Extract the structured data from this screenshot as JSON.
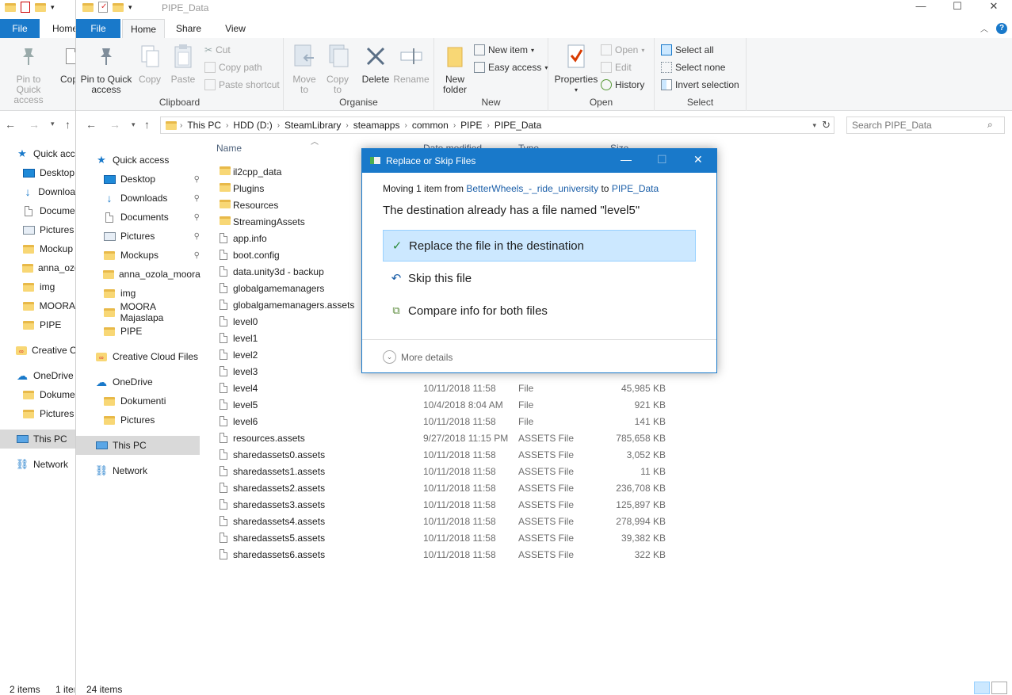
{
  "back_window": {
    "file_tab": "File",
    "home_tab": "Home",
    "ribbon": {
      "pin_label": "Pin to Quick access",
      "copy_partial": "Cop"
    },
    "nav_items": [
      {
        "label": "Quick acc",
        "icon": "star-icon"
      },
      {
        "label": "Desktop",
        "icon": "desktop-icon"
      },
      {
        "label": "Downloa",
        "icon": "download-icon"
      },
      {
        "label": "Docume",
        "icon": "document-icon"
      },
      {
        "label": "Pictures",
        "icon": "pictures-icon"
      },
      {
        "label": "Mockup",
        "icon": "folder-icon"
      },
      {
        "label": "anna_ozo",
        "icon": "folder-icon"
      },
      {
        "label": "img",
        "icon": "folder-icon"
      },
      {
        "label": "MOORA",
        "icon": "folder-icon"
      },
      {
        "label": "PIPE",
        "icon": "folder-icon"
      },
      {
        "label": "Creative C",
        "icon": "creative-cloud-icon"
      },
      {
        "label": "OneDrive",
        "icon": "onedrive-icon"
      },
      {
        "label": "Dokume",
        "icon": "folder-icon"
      },
      {
        "label": "Pictures",
        "icon": "folder-icon"
      },
      {
        "label": "This PC",
        "icon": "this-pc-icon"
      },
      {
        "label": "Network",
        "icon": "network-icon"
      }
    ],
    "status_items": "2 items",
    "status_selected": "1 iter"
  },
  "window": {
    "title": "PIPE_Data",
    "tabs": {
      "file": "File",
      "home": "Home",
      "share": "Share",
      "view": "View"
    },
    "ribbon": {
      "clipboard": {
        "label": "Clipboard",
        "pin": "Pin to Quick access",
        "copy": "Copy",
        "paste": "Paste",
        "cut": "Cut",
        "copy_path": "Copy path",
        "paste_shortcut": "Paste shortcut"
      },
      "organise": {
        "label": "Organise",
        "move_to": "Move to",
        "copy_to": "Copy to",
        "delete": "Delete",
        "rename": "Rename"
      },
      "new": {
        "label": "New",
        "new_folder": "New folder",
        "new_item": "New item",
        "easy_access": "Easy access"
      },
      "open": {
        "label": "Open",
        "properties": "Properties",
        "open": "Open",
        "edit": "Edit",
        "history": "History"
      },
      "select": {
        "label": "Select",
        "select_all": "Select all",
        "select_none": "Select none",
        "invert": "Invert selection"
      }
    },
    "breadcrumb": [
      "This PC",
      "HDD (D:)",
      "SteamLibrary",
      "steamapps",
      "common",
      "PIPE",
      "PIPE_Data"
    ],
    "search_placeholder": "Search PIPE_Data",
    "nav_items": [
      {
        "label": "Quick access",
        "icon": "star-icon",
        "pinned": false
      },
      {
        "label": "Desktop",
        "icon": "desktop-icon",
        "pinned": true
      },
      {
        "label": "Downloads",
        "icon": "download-icon",
        "pinned": true
      },
      {
        "label": "Documents",
        "icon": "document-icon",
        "pinned": true
      },
      {
        "label": "Pictures",
        "icon": "pictures-icon",
        "pinned": true
      },
      {
        "label": "Mockups",
        "icon": "folder-icon",
        "pinned": true
      },
      {
        "label": "anna_ozola_moora",
        "icon": "folder-icon",
        "pinned": false
      },
      {
        "label": "img",
        "icon": "folder-icon",
        "pinned": false
      },
      {
        "label": "MOORA Majaslapa",
        "icon": "folder-icon",
        "pinned": false
      },
      {
        "label": "PIPE",
        "icon": "folder-icon",
        "pinned": false
      },
      {
        "label": "Creative Cloud Files",
        "icon": "creative-cloud-icon",
        "pinned": false
      },
      {
        "label": "OneDrive",
        "icon": "onedrive-icon",
        "pinned": false
      },
      {
        "label": "Dokumenti",
        "icon": "folder-icon",
        "pinned": false
      },
      {
        "label": "Pictures",
        "icon": "folder-icon",
        "pinned": false
      },
      {
        "label": "This PC",
        "icon": "this-pc-icon",
        "pinned": false
      },
      {
        "label": "Network",
        "icon": "network-icon",
        "pinned": false
      }
    ],
    "columns": {
      "name": "Name",
      "date": "Date modified",
      "type": "Type",
      "size": "Size"
    },
    "files": [
      {
        "name": "il2cpp_data",
        "kind": "folder",
        "date": "",
        "type": "",
        "size": ""
      },
      {
        "name": "Plugins",
        "kind": "folder",
        "date": "",
        "type": "",
        "size": ""
      },
      {
        "name": "Resources",
        "kind": "folder",
        "date": "",
        "type": "",
        "size": ""
      },
      {
        "name": "StreamingAssets",
        "kind": "folder",
        "date": "",
        "type": "",
        "size": ""
      },
      {
        "name": "app.info",
        "kind": "file",
        "date": "",
        "type": "",
        "size": ""
      },
      {
        "name": "boot.config",
        "kind": "file",
        "date": "",
        "type": "",
        "size": ""
      },
      {
        "name": "data.unity3d - backup",
        "kind": "file",
        "date": "",
        "type": "",
        "size": ""
      },
      {
        "name": "globalgamemanagers",
        "kind": "file",
        "date": "",
        "type": "",
        "size": ""
      },
      {
        "name": "globalgamemanagers.assets",
        "kind": "file",
        "date": "",
        "type": "",
        "size": ""
      },
      {
        "name": "level0",
        "kind": "file",
        "date": "",
        "type": "",
        "size": ""
      },
      {
        "name": "level1",
        "kind": "file",
        "date": "",
        "type": "",
        "size": ""
      },
      {
        "name": "level2",
        "kind": "file",
        "date": "",
        "type": "",
        "size": ""
      },
      {
        "name": "level3",
        "kind": "file",
        "date": "",
        "type": "",
        "size": ""
      },
      {
        "name": "level4",
        "kind": "file",
        "date": "10/11/2018 11:58",
        "type": "File",
        "size": "45,985 KB"
      },
      {
        "name": "level5",
        "kind": "file",
        "date": "10/4/2018 8:04 AM",
        "type": "File",
        "size": "921 KB"
      },
      {
        "name": "level6",
        "kind": "file",
        "date": "10/11/2018 11:58",
        "type": "File",
        "size": "141 KB"
      },
      {
        "name": "resources.assets",
        "kind": "file",
        "date": "9/27/2018 11:15 PM",
        "type": "ASSETS File",
        "size": "785,658 KB"
      },
      {
        "name": "sharedassets0.assets",
        "kind": "file",
        "date": "10/11/2018 11:58",
        "type": "ASSETS File",
        "size": "3,052 KB"
      },
      {
        "name": "sharedassets1.assets",
        "kind": "file",
        "date": "10/11/2018 11:58",
        "type": "ASSETS File",
        "size": "11 KB"
      },
      {
        "name": "sharedassets2.assets",
        "kind": "file",
        "date": "10/11/2018 11:58",
        "type": "ASSETS File",
        "size": "236,708 KB"
      },
      {
        "name": "sharedassets3.assets",
        "kind": "file",
        "date": "10/11/2018 11:58",
        "type": "ASSETS File",
        "size": "125,897 KB"
      },
      {
        "name": "sharedassets4.assets",
        "kind": "file",
        "date": "10/11/2018 11:58",
        "type": "ASSETS File",
        "size": "278,994 KB"
      },
      {
        "name": "sharedassets5.assets",
        "kind": "file",
        "date": "10/11/2018 11:58",
        "type": "ASSETS File",
        "size": "39,382 KB"
      },
      {
        "name": "sharedassets6.assets",
        "kind": "file",
        "date": "10/11/2018 11:58",
        "type": "ASSETS File",
        "size": "322 KB"
      }
    ],
    "status_items": "24 items"
  },
  "dialog": {
    "title": "Replace or Skip Files",
    "moving_prefix": "Moving 1 item from ",
    "moving_source": "BetterWheels_-_ride_university",
    "moving_to": " to ",
    "moving_dest": "PIPE_Data",
    "message": "The destination already has a file named \"level5\"",
    "options": {
      "replace": "Replace the file in the destination",
      "skip": "Skip this file",
      "compare": "Compare info for both files"
    },
    "more_details": "More details"
  },
  "colors": {
    "accent": "#1979ca",
    "selection": "#cce8ff",
    "link": "#1a5ea8",
    "folder": "#f8d775"
  }
}
